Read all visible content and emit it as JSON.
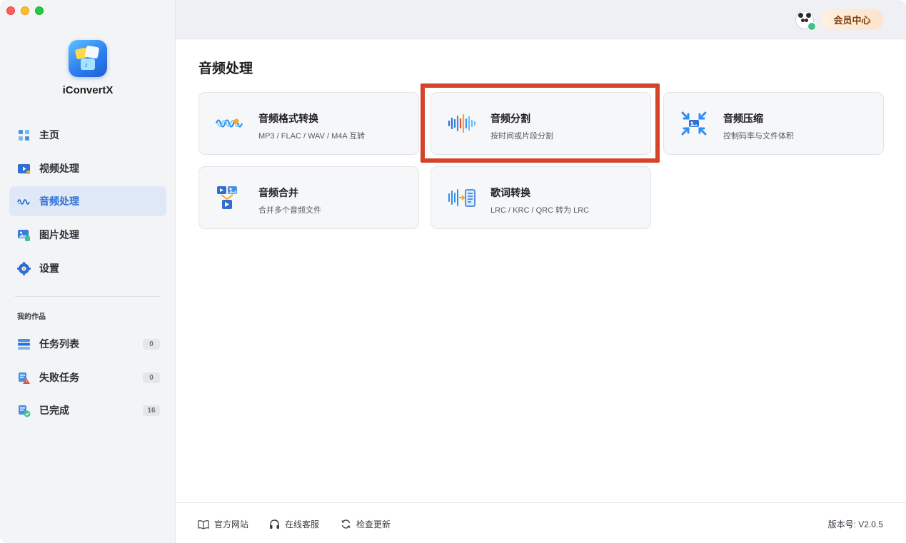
{
  "app": {
    "name": "iConvertX"
  },
  "sidebar": {
    "nav": [
      {
        "id": "home",
        "label": "主页",
        "active": false
      },
      {
        "id": "video",
        "label": "视频处理",
        "active": false
      },
      {
        "id": "audio",
        "label": "音频处理",
        "active": true
      },
      {
        "id": "image",
        "label": "图片处理",
        "active": false
      },
      {
        "id": "settings",
        "label": "设置",
        "active": false
      }
    ],
    "section_title": "我的作品",
    "works": [
      {
        "id": "tasks",
        "label": "任务列表",
        "count": "0"
      },
      {
        "id": "failed",
        "label": "失败任务",
        "count": "0"
      },
      {
        "id": "done",
        "label": "已完成",
        "count": "16"
      }
    ]
  },
  "topbar": {
    "member_label": "会员中心"
  },
  "main": {
    "title": "音频处理",
    "cards": [
      {
        "id": "format",
        "title": "音频格式转换",
        "subtitle": "MP3 / FLAC / WAV / M4A 互转"
      },
      {
        "id": "split",
        "title": "音频分割",
        "subtitle": "按时间或片段分割",
        "highlighted": true
      },
      {
        "id": "compress",
        "title": "音频压缩",
        "subtitle": "控制码率与文件体积"
      },
      {
        "id": "merge",
        "title": "音频合并",
        "subtitle": "合并多个音频文件"
      },
      {
        "id": "lyrics",
        "title": "歌词转换",
        "subtitle": "LRC / KRC / QRC 转为 LRC"
      }
    ]
  },
  "footer": {
    "website": "官方网站",
    "support": "在线客服",
    "update": "检查更新",
    "version": "版本号:  V2.0.5"
  },
  "colors": {
    "accent": "#2d6fd6",
    "highlight": "#d4432a",
    "active_bg": "#dfe8f7"
  }
}
